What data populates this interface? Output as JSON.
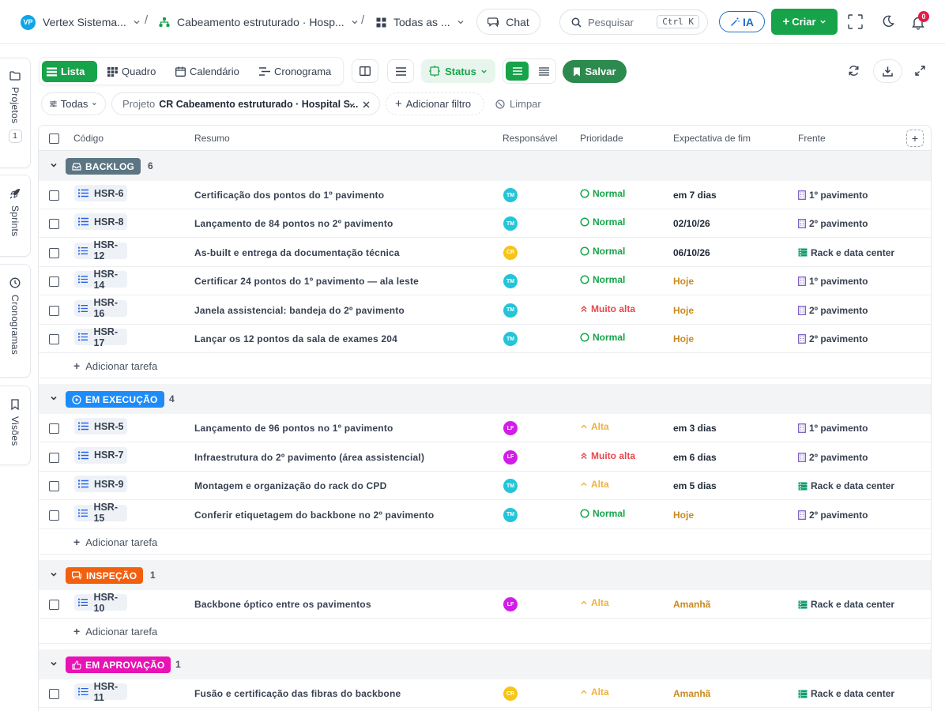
{
  "topbar": {
    "workspace_initials": "VP",
    "workspace": "Vertex Sistema...",
    "project": "Cabeamento estruturado · Hosp...",
    "view": "Todas as ...",
    "chat": "Chat",
    "search_placeholder": "Pesquisar",
    "search_shortcut": "Ctrl K",
    "ai": "IA",
    "create": "Criar",
    "notifications": "0"
  },
  "sidebar": {
    "tabs": [
      {
        "label": "Projetos",
        "badge": "1"
      },
      {
        "label": "Sprints"
      },
      {
        "label": "Cronogramas"
      },
      {
        "label": "Visões"
      }
    ]
  },
  "toolbar": {
    "views": [
      "Lista",
      "Quadro",
      "Calendário",
      "Cronograma"
    ],
    "status": "Status",
    "save": "Salvar"
  },
  "filters": {
    "all": "Todas",
    "project_label": "Projeto",
    "project_value": "CR Cabeamento estruturado · Hospital S...",
    "add_filter": "Adicionar filtro",
    "clear": "Limpar"
  },
  "columns": [
    "Código",
    "Resumo",
    "Responsável",
    "Prioridade",
    "Expectativa de fim",
    "Frente"
  ],
  "add_task": "Adicionar tarefa",
  "colors": {
    "green": "#16a34a",
    "backlog": "#5b7583",
    "exec": "#1d8cf8",
    "insp": "#f2600f",
    "aprov": "#e812b5",
    "tm": "#22c5d9",
    "cr": "#f5c518",
    "lf": "#d11ee6",
    "high": "#f0b13c",
    "veryhigh": "#e5484d",
    "normal": "#16a34a",
    "due_warn": "#c98a1e"
  },
  "groups": [
    {
      "name": "BACKLOG",
      "count": "6",
      "tasks": [
        {
          "code": "HSR-6",
          "summary": "Certificação dos pontos do 1º pavimento",
          "owner": "TM",
          "priority": "Normal",
          "due": "em 7 dias",
          "front": "1º pavimento"
        },
        {
          "code": "HSR-8",
          "summary": "Lançamento de 84 pontos no 2º pavimento",
          "owner": "TM",
          "priority": "Normal",
          "due": "02/10/26",
          "front": "2º pavimento"
        },
        {
          "code": "HSR-12",
          "summary": "As-built e entrega da documentação técnica",
          "owner": "CR",
          "priority": "Normal",
          "due": "06/10/26",
          "front": "Rack e data center"
        },
        {
          "code": "HSR-14",
          "summary": "Certificar 24 pontos do 1º pavimento — ala leste",
          "owner": "TM",
          "priority": "Normal",
          "due": "Hoje",
          "front": "1º pavimento"
        },
        {
          "code": "HSR-16",
          "summary": "Janela assistencial: bandeja do 2º pavimento",
          "owner": "TM",
          "priority": "Muito alta",
          "due": "Hoje",
          "front": "2º pavimento"
        },
        {
          "code": "HSR-17",
          "summary": "Lançar os 12 pontos da sala de exames 204",
          "owner": "TM",
          "priority": "Normal",
          "due": "Hoje",
          "front": "2º pavimento"
        }
      ]
    },
    {
      "name": "EM EXECUÇÃO",
      "count": "4",
      "tasks": [
        {
          "code": "HSR-5",
          "summary": "Lançamento de 96 pontos no 1º pavimento",
          "owner": "LF",
          "priority": "Alta",
          "due": "em 3 dias",
          "front": "1º pavimento"
        },
        {
          "code": "HSR-7",
          "summary": "Infraestrutura do 2º pavimento (área assistencial)",
          "owner": "LF",
          "priority": "Muito alta",
          "due": "em 6 dias",
          "front": "2º pavimento"
        },
        {
          "code": "HSR-9",
          "summary": "Montagem e organização do rack do CPD",
          "owner": "TM",
          "priority": "Alta",
          "due": "em 5 dias",
          "front": "Rack e data center"
        },
        {
          "code": "HSR-15",
          "summary": "Conferir etiquetagem do backbone no 2º pavimento",
          "owner": "TM",
          "priority": "Normal",
          "due": "Hoje",
          "front": "2º pavimento"
        }
      ]
    },
    {
      "name": "INSPEÇÃO",
      "count": "1",
      "tasks": [
        {
          "code": "HSR-10",
          "summary": "Backbone óptico entre os pavimentos",
          "owner": "LF",
          "priority": "Alta",
          "due": "Amanhã",
          "front": "Rack e data center"
        }
      ]
    },
    {
      "name": "EM APROVAÇÃO",
      "count": "1",
      "tasks": [
        {
          "code": "HSR-11",
          "summary": "Fusão e certificação das fibras do backbone",
          "owner": "CR",
          "priority": "Alta",
          "due": "Amanhã",
          "front": "Rack e data center"
        }
      ]
    }
  ]
}
